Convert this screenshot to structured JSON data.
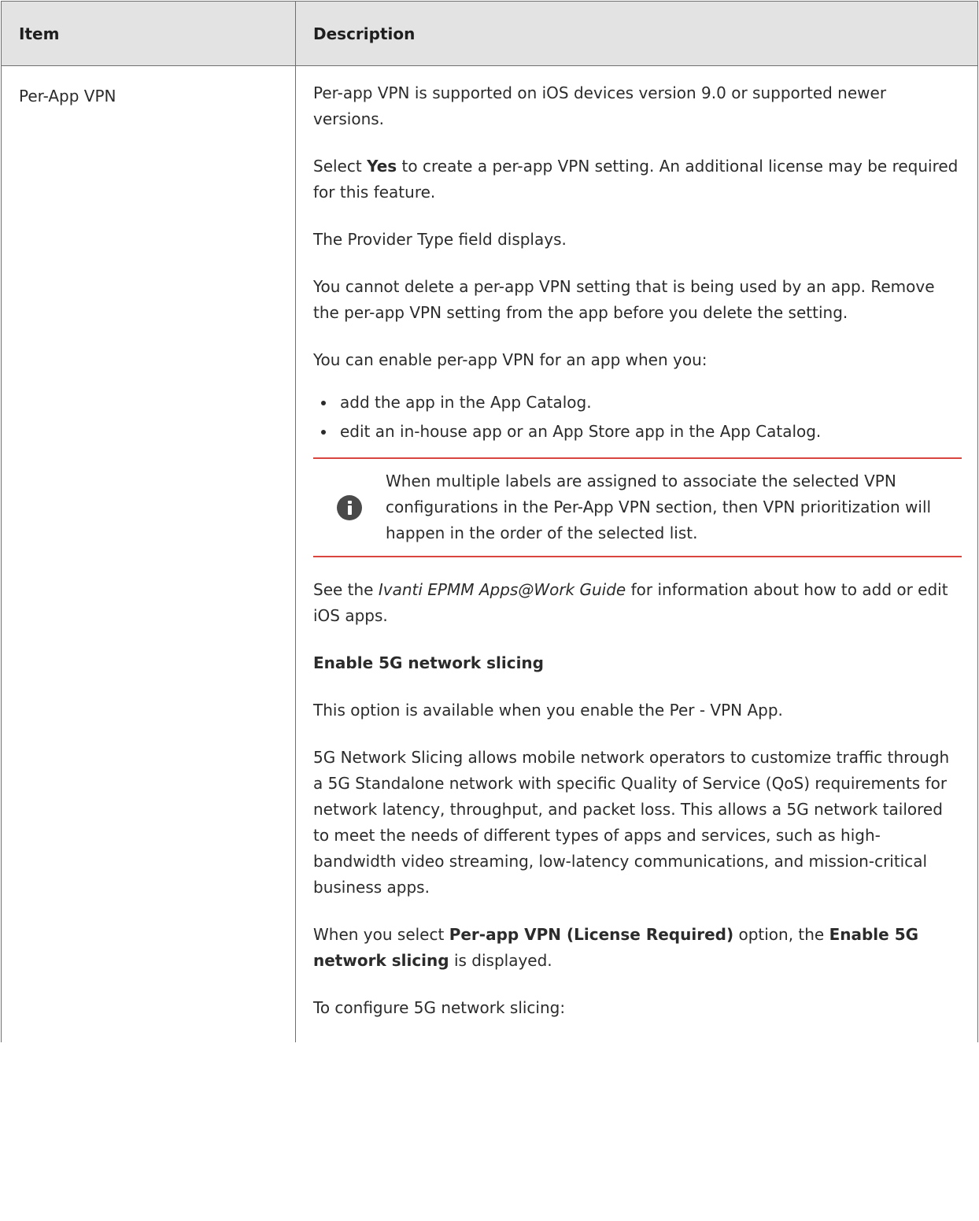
{
  "table": {
    "headers": {
      "item": "Item",
      "description": "Description"
    },
    "row": {
      "item": "Per-App VPN",
      "p1": "Per-app VPN is supported on iOS devices version 9.0 or supported newer versions.",
      "p2": {
        "a": "Select ",
        "b": "Yes",
        "c": " to create a per-app VPN setting. An additional license may be required for this feature."
      },
      "p3": "The Provider Type field displays.",
      "p4": "You cannot delete a per-app VPN setting that is being used by an app. Remove the per-app VPN setting from the app before you delete the setting.",
      "p5": "You can enable per-app VPN for an app when you:",
      "bullets": [
        "add the app in the App Catalog.",
        "edit an in-house app or an App Store app in the App Catalog."
      ],
      "note": {
        "icon": "info-icon",
        "text": "When multiple labels are assigned to associate the selected VPN configurations in the Per-App VPN section, then VPN prioritization will happen in the order of the selected list."
      },
      "p6": {
        "a": "See the ",
        "b": "Ivanti EPMM Apps@Work Guide",
        "c": " for information about how to add or edit iOS apps."
      },
      "heading": "Enable 5G network slicing",
      "p7": "This option is available when you enable the Per - VPN App.",
      "p8": "5G Network Slicing allows mobile network operators to customize traffic through a 5G Standalone network with specific Quality of Service (QoS) requirements for network latency, throughput, and packet loss. This allows a 5G network tailored to meet the needs of different types of apps and services, such as high-bandwidth video streaming, low-latency communications, and mission-critical business apps.",
      "p9": {
        "a": "When you select ",
        "b": "Per-app VPN (License Required)",
        "c": " option, the ",
        "d": "Enable 5G network slicing",
        "e": " is displayed."
      },
      "p10": "To configure 5G network slicing:"
    }
  },
  "colors": {
    "header_bg": "#e3e3e3",
    "note_rule": "#d9463f",
    "border": "#6f6f6f"
  }
}
